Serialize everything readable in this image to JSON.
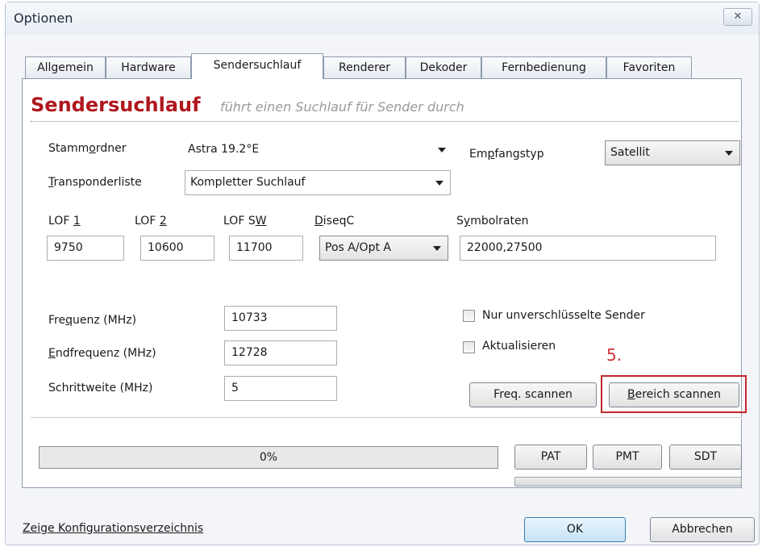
{
  "window": {
    "title": "Optionen",
    "close_icon": "close-icon"
  },
  "tabs": [
    {
      "label": "Allgemein"
    },
    {
      "label": "Hardware"
    },
    {
      "label": "Sendersuchlauf",
      "active": true
    },
    {
      "label": "Renderer"
    },
    {
      "label": "Dekoder"
    },
    {
      "label": "Fernbedienung"
    },
    {
      "label": "Favoriten"
    }
  ],
  "header": {
    "title": "Sendersuchlauf",
    "subtitle": "führt einen Suchlauf für Sender durch",
    "title_color": "#b0171d"
  },
  "form": {
    "stammordner": {
      "label_pre": "Stamm",
      "label_mn": "o",
      "label_post": "rdner",
      "value": "Astra 19.2°E"
    },
    "empfangstyp": {
      "label_pre": "Em",
      "label_mn": "p",
      "label_post": "fangstyp",
      "value": "Satellit"
    },
    "transponderliste": {
      "label_mn": "T",
      "label_post": "ransponderliste",
      "value": "Kompletter Suchlauf"
    },
    "lof1": {
      "label_pre": "LOF ",
      "label_mn": "1",
      "value": "9750"
    },
    "lof2": {
      "label_pre": "LOF ",
      "label_mn": "2",
      "value": "10600"
    },
    "lofsw": {
      "label_pre": "LOF S",
      "label_mn": "W",
      "value": "11700"
    },
    "diseqc": {
      "label_mn": "D",
      "label_post": "iseqC",
      "value": "Pos A/Opt A"
    },
    "symbolraten": {
      "label_pre": "S",
      "label_mn": "y",
      "label_post": "mbolraten",
      "value": "22000,27500"
    },
    "frequenz": {
      "label_pre": "Fre",
      "label_mn": "q",
      "label_post": "uenz (MHz)",
      "value": "10733"
    },
    "endfrequenz": {
      "label_mn": "E",
      "label_post": "ndfrequenz (MHz)",
      "value": "12728"
    },
    "schrittweite": {
      "label": "Schrittweite (MHz)",
      "value": "5"
    },
    "nur_unverschluesselt": {
      "label": "Nur unverschlüsselte Sender",
      "checked": false
    },
    "aktualisieren": {
      "label": "Aktualisieren",
      "checked": false
    }
  },
  "buttons": {
    "freq_scannen": "Freq. scannen",
    "bereich_scannen_mn": "B",
    "bereich_scannen_post": "ereich scannen",
    "pat": "PAT",
    "pmt": "PMT",
    "sdt": "SDT",
    "ok": "OK",
    "abbrechen": "Abbrechen"
  },
  "annotation": {
    "step": "5.",
    "color": "#c0272d"
  },
  "progress": {
    "label": "0%",
    "value": 0
  },
  "footer": {
    "config_link": "Zeige Konfigurationsverzeichnis"
  }
}
